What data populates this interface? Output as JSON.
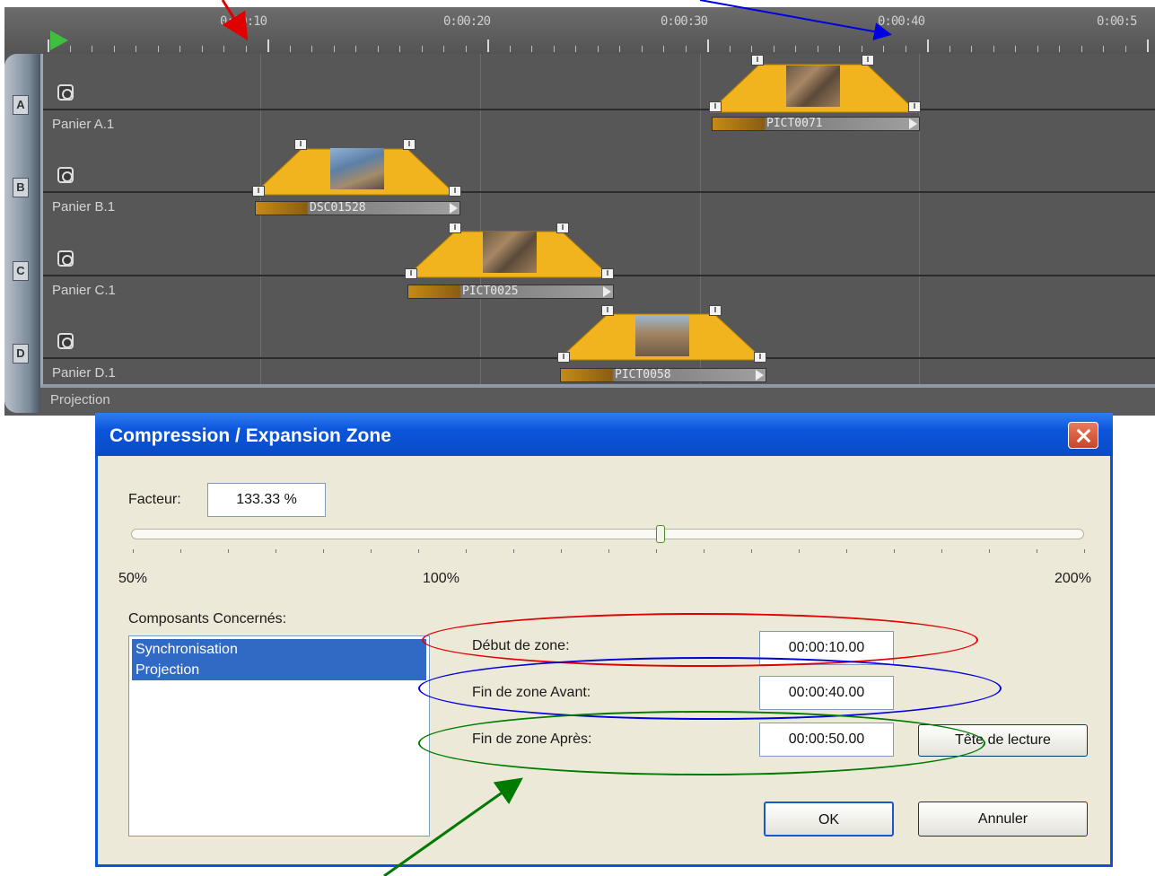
{
  "timeline": {
    "ruler_labels": [
      "0:00:10",
      "0:00:20",
      "0:00:30",
      "0:00:40",
      "0:00:5"
    ],
    "tracks": [
      {
        "letter": "A",
        "name": "Panier A.1",
        "clip": "PICT0071"
      },
      {
        "letter": "B",
        "name": "Panier B.1",
        "clip": "DSC01528"
      },
      {
        "letter": "C",
        "name": "Panier C.1",
        "clip": "PICT0025"
      },
      {
        "letter": "D",
        "name": "Panier D.1",
        "clip": "PICT0058"
      }
    ],
    "bottom_label": "Projection"
  },
  "dialog": {
    "title": "Compression / Expansion Zone",
    "facteur_label": "Facteur:",
    "facteur_value": "133.33 %",
    "slider": {
      "min_label": "50%",
      "mid_label": "100%",
      "max_label": "200%",
      "value_percent": 133.33
    },
    "components_label": "Composants Concernés:",
    "components": [
      "Synchronisation",
      "Projection"
    ],
    "debut_label": "Début de zone:",
    "debut_value": "00:00:10.00",
    "fin_avant_label": "Fin de zone Avant:",
    "fin_avant_value": "00:00:40.00",
    "fin_apres_label": "Fin de zone Après:",
    "fin_apres_value": "00:00:50.00",
    "tete_button": "Tête de lecture",
    "ok_button": "OK",
    "cancel_button": "Annuler"
  },
  "annotation_colors": {
    "red": "#e00000",
    "blue": "#0000e0",
    "green": "#007a00"
  }
}
